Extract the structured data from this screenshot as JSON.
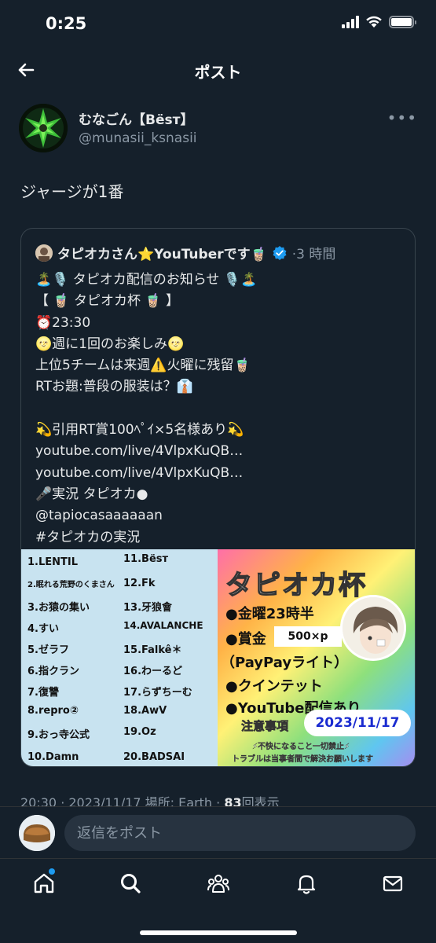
{
  "status": {
    "time": "0:25"
  },
  "nav": {
    "title": "ポスト"
  },
  "post": {
    "author_name": "むなごん【Bësт】",
    "author_handle": "@munasii_ksnasii",
    "text": "ジャージが1番"
  },
  "quote": {
    "name": "タピオカさん⭐YouTuberです🧋",
    "time": "·3 時間",
    "lines": [
      "🏝️🎙️ タピオカ配信のお知らせ 🎙️🏝️",
      "【 🧋 タピオカ杯 🧋 】",
      "⏰23:30",
      "🌝週に1回のお楽しみ🌝",
      "上位5チームは来週⚠️火曜に残留🧋",
      "RTお題:普段の服装は？👔",
      "",
      "💫引用RT賞100ﾍﾟｲ×5名様あり💫",
      "youtube.com/live/4VlpxKuQB…",
      "youtube.com/live/4VlpxKuQB…",
      "🎤実況 タピオカ●",
      "@tapiocasaaaaaan",
      "#タピオカの実況"
    ]
  },
  "promo": {
    "teams_left": [
      "1.LENTIL",
      "2.眠れる荒野のくまさん",
      "3.お猿の集い",
      "4.すい",
      "5.ゼラフ",
      "6.指クラン",
      "7.復讐",
      "8.repro②",
      "9.おっ寺公式",
      "10.Damn"
    ],
    "teams_right": [
      "11.Bësт",
      "12.Fk",
      "13.牙狼會",
      "14.AVALANCHE",
      "15.Falkê＊",
      "16.わーるど",
      "17.らずちーむ",
      "18.AwV",
      "19.Oz",
      "20.BADSAI"
    ],
    "title": "タピオカ杯",
    "line1": "●金曜23時半",
    "line2": "●賞金",
    "prize": "500×p",
    "line3": "（PayPayライト）",
    "line4": "●クインテット",
    "line5": "●YouTube配信あり",
    "note_title": "注意事項",
    "date": "2023/11/17",
    "note1": "⚡不快になること一切禁止⚡",
    "note2": "トラブルは当事者間で解決お願いします"
  },
  "meta": {
    "prefix": "20:30 · 2023/11/17 場所: Earth · ",
    "views": "83",
    "suffix": "回表示"
  },
  "reply": {
    "placeholder": "返信をポスト"
  },
  "colors": {
    "background": "#15202b",
    "accent": "#1d9bf0",
    "muted": "#8b98a5"
  }
}
